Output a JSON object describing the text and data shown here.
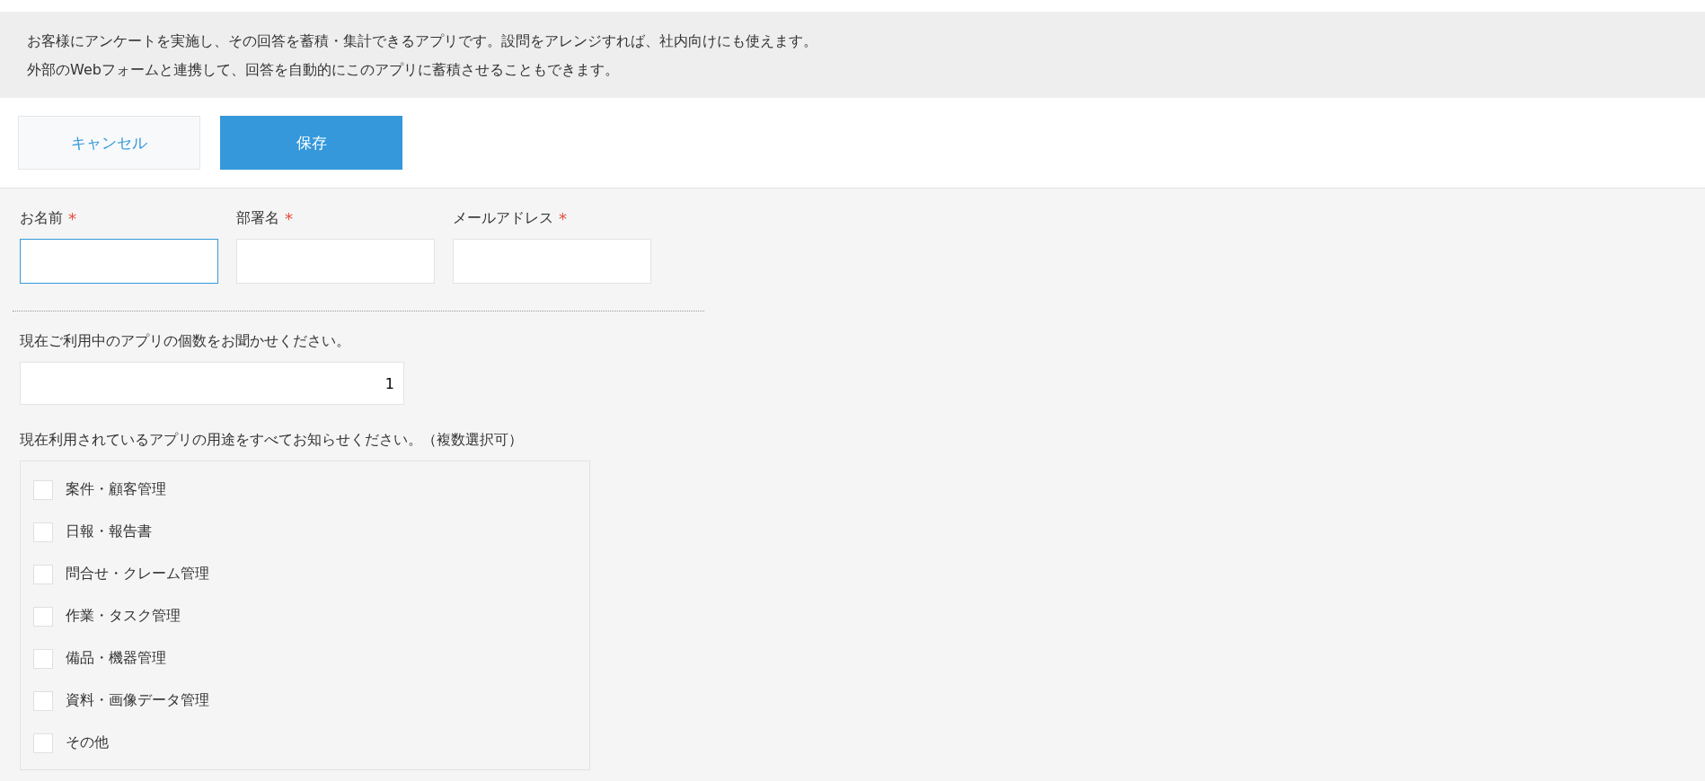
{
  "description": [
    "お客様にアンケートを実施し、その回答を蓄積・集計できるアプリです。設問をアレンジすれば、社内向けにも使えます。",
    "外部のWebフォームと連携して、回答を自動的にこのアプリに蓄積させることもできます。"
  ],
  "buttons": [
    {
      "label": "キャンセル",
      "kind": "secondary"
    },
    {
      "label": "保存",
      "kind": "primary"
    }
  ],
  "fields": [
    {
      "label": "お名前",
      "required_mark": "*",
      "focused": true
    },
    {
      "label": "部署名",
      "required_mark": "*",
      "focused": false
    },
    {
      "label": "メールアドレス",
      "required_mark": "*",
      "focused": false
    }
  ],
  "number_question": {
    "label": "現在ご利用中のアプリの個数をお聞かせください。",
    "value": "1"
  },
  "checkbox_question": {
    "label": "現在利用されているアプリの用途をすべてお知らせください。（複数選択可）",
    "options": [
      {
        "label": "案件・顧客管理",
        "checked": false
      },
      {
        "label": "日報・報告書",
        "checked": false
      },
      {
        "label": "問合せ・クレーム管理",
        "checked": false
      },
      {
        "label": "作業・タスク管理",
        "checked": false
      },
      {
        "label": "備品・機器管理",
        "checked": false
      },
      {
        "label": "資料・画像データ管理",
        "checked": false
      },
      {
        "label": "その他",
        "checked": false
      }
    ]
  }
}
